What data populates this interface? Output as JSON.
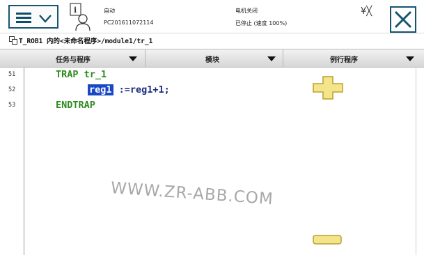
{
  "header": {
    "mode": "自动",
    "controller_id": "PC201611072114",
    "motor_status": "电机关闭",
    "run_status": "已停止 (速度 100%)",
    "menu_icon": "hamburger-menu-icon",
    "user_icon": "user-info-icon",
    "tray_icons": "¥╳",
    "close_icon": "close-icon"
  },
  "breadcrumb": {
    "icon": "program-path-icon",
    "text": "T_ROB1 内的<未命名程序>/module1/tr_1"
  },
  "tabs": [
    {
      "label": "任务与程序"
    },
    {
      "label": "模块"
    },
    {
      "label": "例行程序"
    }
  ],
  "editor": {
    "line_numbers": [
      "51",
      "52",
      "53"
    ],
    "lines": [
      {
        "indent": "",
        "keyword": "TRAP",
        "text": " tr_1"
      },
      {
        "indent": "    ",
        "selected": "reg1",
        "text": " :=reg1+1;"
      },
      {
        "indent": "",
        "keyword": "ENDTRAP",
        "text": ""
      }
    ],
    "watermark": "WWW.ZR-ABB.COM",
    "zoom_in_icon": "plus-zoom-icon",
    "zoom_out_icon": "minus-zoom-icon"
  },
  "colors": {
    "accent": "#15556e",
    "keyword": "#2e8b1f",
    "selection": "#1848c4",
    "zoom_button": "#f4e48a"
  }
}
